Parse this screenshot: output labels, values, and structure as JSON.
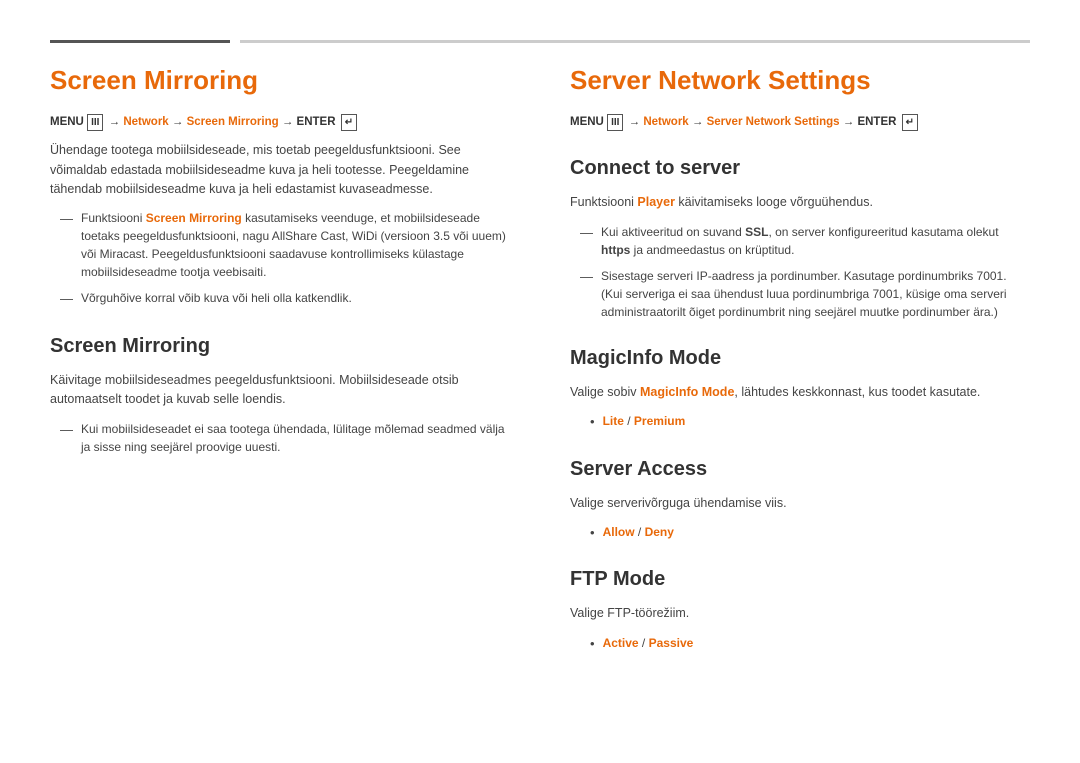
{
  "left": {
    "title": "Screen Mirroring",
    "menu_path": {
      "prefix": "MENU",
      "menu_icon": "III",
      "arrow1": "→",
      "network": "Network",
      "arrow2": "→",
      "screen_mirroring": "Screen Mirroring",
      "arrow3": "→",
      "enter": "ENTER",
      "enter_icon": "↵"
    },
    "intro": "Ühendage tootega mobiilsideseade, mis toetab peegeldusfunktsiooni. See võimaldab edastada mobiilsideseadme kuva ja heli tootesse. Peegeldamine tähendab mobiilsideseadme kuva ja heli edastamist kuvaseadmesse.",
    "dash_items": [
      {
        "text_parts": [
          {
            "text": "Funktsiooni ",
            "style": "normal"
          },
          {
            "text": "Screen Mirroring",
            "style": "orange"
          },
          {
            "text": " kasutamiseks veenduge, et mobiilsideseade toetaks peegeldusfunktsiooni, nagu AllShare Cast, WiDi (versioon 3.5 või uuem) või Miracast. Peegeldusfunktsiooni saadavuse kontrollimiseks külastage mobiilsideseadme tootja veebisaiti.",
            "style": "normal"
          }
        ]
      },
      {
        "text_parts": [
          {
            "text": "Võrguhõive korral võib kuva või heli olla katkendlik.",
            "style": "normal"
          }
        ]
      }
    ],
    "subsection_title": "Screen Mirroring",
    "subsection_body": "Käivitage mobiilsideseadmes peegeldusfunktsiooni. Mobiilsideseade otsib automaatselt toodet ja kuvab selle loendis.",
    "subsection_dash": [
      {
        "text_parts": [
          {
            "text": "Kui mobiilsideseadet ei saa tootega ühendada, lülitage mõlemad seadmed välja ja sisse ning seejärel proovige uuesti.",
            "style": "normal"
          }
        ]
      }
    ]
  },
  "right": {
    "title": "Server Network Settings",
    "menu_path": {
      "prefix": "MENU",
      "menu_icon": "III",
      "arrow1": "→",
      "network": "Network",
      "arrow2": "→",
      "server_network": "Server Network Settings",
      "arrow3": "→",
      "enter": "ENTER",
      "enter_icon": "↵"
    },
    "connect": {
      "title": "Connect to server",
      "body_parts": [
        {
          "text": "Funktsiooni ",
          "style": "normal"
        },
        {
          "text": "Player",
          "style": "orange"
        },
        {
          "text": " käivitamiseks looge võrguühendus.",
          "style": "normal"
        }
      ],
      "dash_items": [
        {
          "text_parts": [
            {
              "text": "Kui aktiveeritud on suvand ",
              "style": "normal"
            },
            {
              "text": "SSL",
              "style": "bold"
            },
            {
              "text": ", on server konfigureeritud kasutama olekut ",
              "style": "normal"
            },
            {
              "text": "https",
              "style": "bold"
            },
            {
              "text": " ja andmeedastus on krüptitud.",
              "style": "normal"
            }
          ]
        },
        {
          "text_parts": [
            {
              "text": "Sisestage serveri IP-aadress ja pordinumber. Kasutage pordinumbriks 7001. (Kui serveriga ei saa ühendust luua pordinumbriga 7001, küsige oma serveri administraatorilt õiget pordinumbrit ning seejärel muutke pordinumber ära.)",
              "style": "normal"
            }
          ]
        }
      ]
    },
    "magicinfo": {
      "title": "MagicInfo Mode",
      "body_parts": [
        {
          "text": "Valige sobiv ",
          "style": "normal"
        },
        {
          "text": "MagicInfo Mode",
          "style": "orange"
        },
        {
          "text": ", lähtudes keskkonnast, kus toodet kasutate.",
          "style": "normal"
        }
      ],
      "bullet_items": [
        {
          "text_parts": [
            {
              "text": "Lite",
              "style": "orange"
            },
            {
              "text": " / ",
              "style": "normal"
            },
            {
              "text": "Premium",
              "style": "orange"
            }
          ]
        }
      ]
    },
    "server_access": {
      "title": "Server Access",
      "body": "Valige serverivõrguga ühendamise viis.",
      "bullet_items": [
        {
          "text_parts": [
            {
              "text": "Allow",
              "style": "orange"
            },
            {
              "text": " / ",
              "style": "normal"
            },
            {
              "text": "Deny",
              "style": "orange"
            }
          ]
        }
      ]
    },
    "ftp_mode": {
      "title": "FTP Mode",
      "body": "Valige FTP-töörežiim.",
      "bullet_items": [
        {
          "text_parts": [
            {
              "text": "Active",
              "style": "orange"
            },
            {
              "text": " / ",
              "style": "normal"
            },
            {
              "text": "Passive",
              "style": "orange"
            }
          ]
        }
      ]
    }
  }
}
